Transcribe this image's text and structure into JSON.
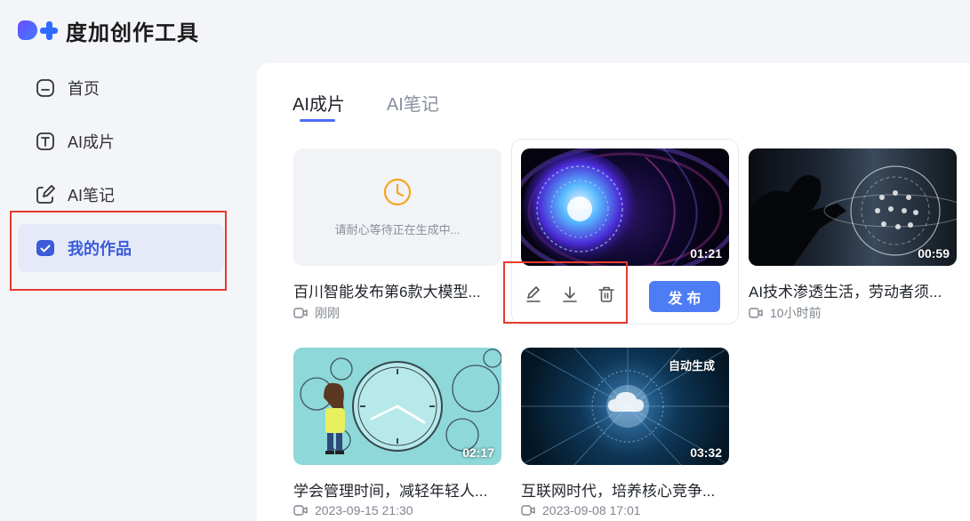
{
  "app": {
    "title": "度加创作工具"
  },
  "sidebar": {
    "items": [
      {
        "label": "首页",
        "icon": "home-icon"
      },
      {
        "label": "AI成片",
        "icon": "text-t-icon"
      },
      {
        "label": "AI笔记",
        "icon": "pen-icon"
      },
      {
        "label": "我的作品",
        "icon": "folder-check-icon",
        "active": true
      }
    ]
  },
  "tabs": [
    {
      "label": "AI成片",
      "active": true
    },
    {
      "label": "AI笔记",
      "active": false
    }
  ],
  "pending": {
    "message": "请耐心等待正在生成中..."
  },
  "cards": [
    {
      "title": "百川智能发布第6款大模型...",
      "meta": "刚刚",
      "duration": "",
      "badge": ""
    },
    {
      "title": "",
      "meta": "",
      "duration": "01:21",
      "badge": ""
    },
    {
      "title": "AI技术渗透生活，劳动者须...",
      "meta": "10小时前",
      "duration": "00:59",
      "badge": ""
    },
    {
      "title": "学会管理时间，减轻年轻人...",
      "meta": "2023-09-15 21:30",
      "duration": "02:17",
      "badge": ""
    },
    {
      "title": "互联网时代，培养核心竞争...",
      "meta": "2023-09-08 17:01",
      "duration": "03:32",
      "badge": "自动生成"
    }
  ],
  "actions": {
    "publish_label": "发布",
    "icons": [
      "edit-icon",
      "download-icon",
      "delete-icon"
    ]
  },
  "colors": {
    "accent": "#4e7cf5",
    "highlight": "#e8392e",
    "active_bg": "#e6eaf8"
  }
}
